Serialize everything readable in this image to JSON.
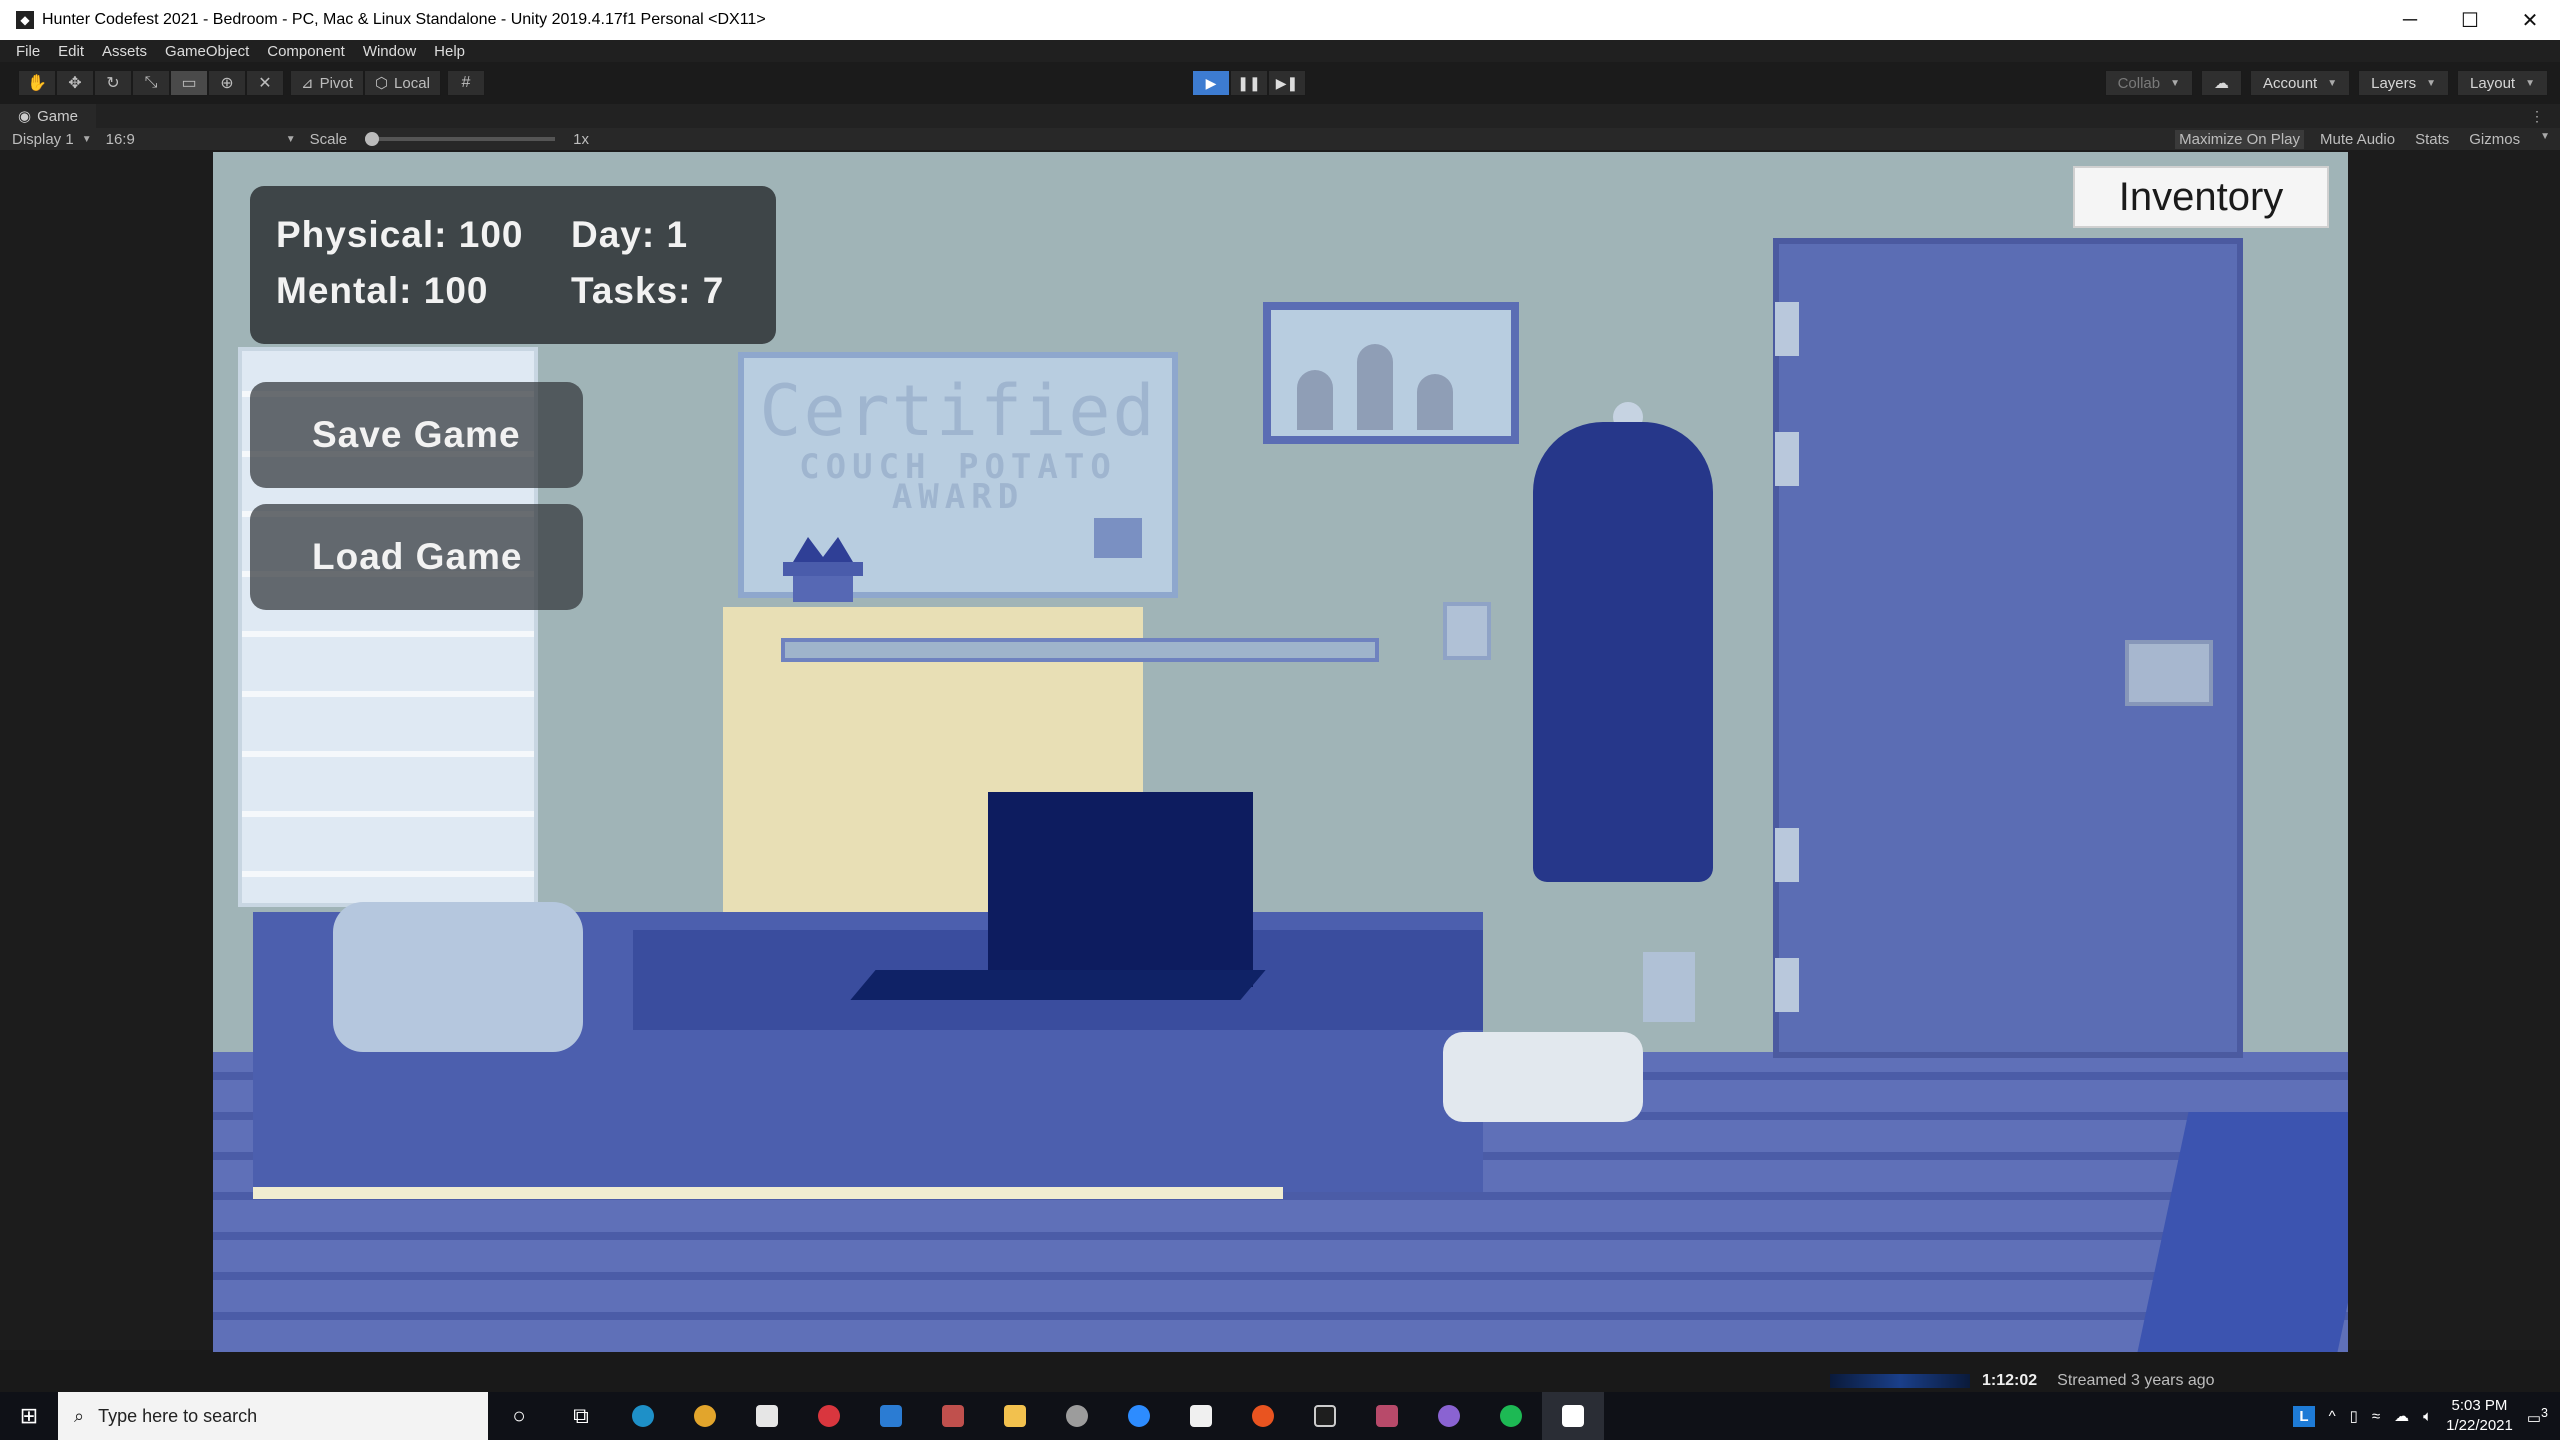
{
  "window": {
    "title": "Hunter Codefest 2021 - Bedroom - PC, Mac & Linux Standalone - Unity 2019.4.17f1 Personal <DX11>",
    "min": "─",
    "max": "☐",
    "close": "✕"
  },
  "menu": [
    "File",
    "Edit",
    "Assets",
    "GameObject",
    "Component",
    "Window",
    "Help"
  ],
  "toolbar": {
    "pivot": "Pivot",
    "local": "Local",
    "collab": "Collab",
    "account": "Account",
    "layers": "Layers",
    "layout": "Layout",
    "play_state": "playing"
  },
  "tab": {
    "label": "Game"
  },
  "game_view": {
    "display": "Display 1",
    "aspect": "16:9",
    "scale_label": "Scale",
    "scale_value": "1x",
    "maximize": "Maximize On Play",
    "mute": "Mute Audio",
    "stats": "Stats",
    "gizmos": "Gizmos"
  },
  "hud": {
    "physical": "Physical: 100",
    "mental": "Mental: 100",
    "day": "Day: 1",
    "tasks": "Tasks: 7"
  },
  "buttons": {
    "save": "Save Game",
    "load": "Load Game",
    "inventory": "Inventory"
  },
  "scene": {
    "certificate_title": "Certified",
    "certificate_sub1": "COUCH POTATO",
    "certificate_sub2": "AWARD"
  },
  "stream": {
    "time": "1:12:02",
    "status": "Streamed 3 years ago"
  },
  "taskbar": {
    "search_placeholder": "Type here to search",
    "time": "5:03 PM",
    "date": "1/22/2021",
    "notifications": "3",
    "icons": [
      "cortana-icon",
      "task-view-icon",
      "edge-icon",
      "chrome-icon",
      "store-icon",
      "app-red-icon",
      "mail-icon",
      "app-character-icon",
      "file-explorer-icon",
      "app-wolf-icon",
      "zoom-icon",
      "files-icon",
      "ubuntu-icon",
      "terminal-icon",
      "app-game-icon",
      "github-icon",
      "spotify-icon",
      "unity-icon"
    ]
  }
}
